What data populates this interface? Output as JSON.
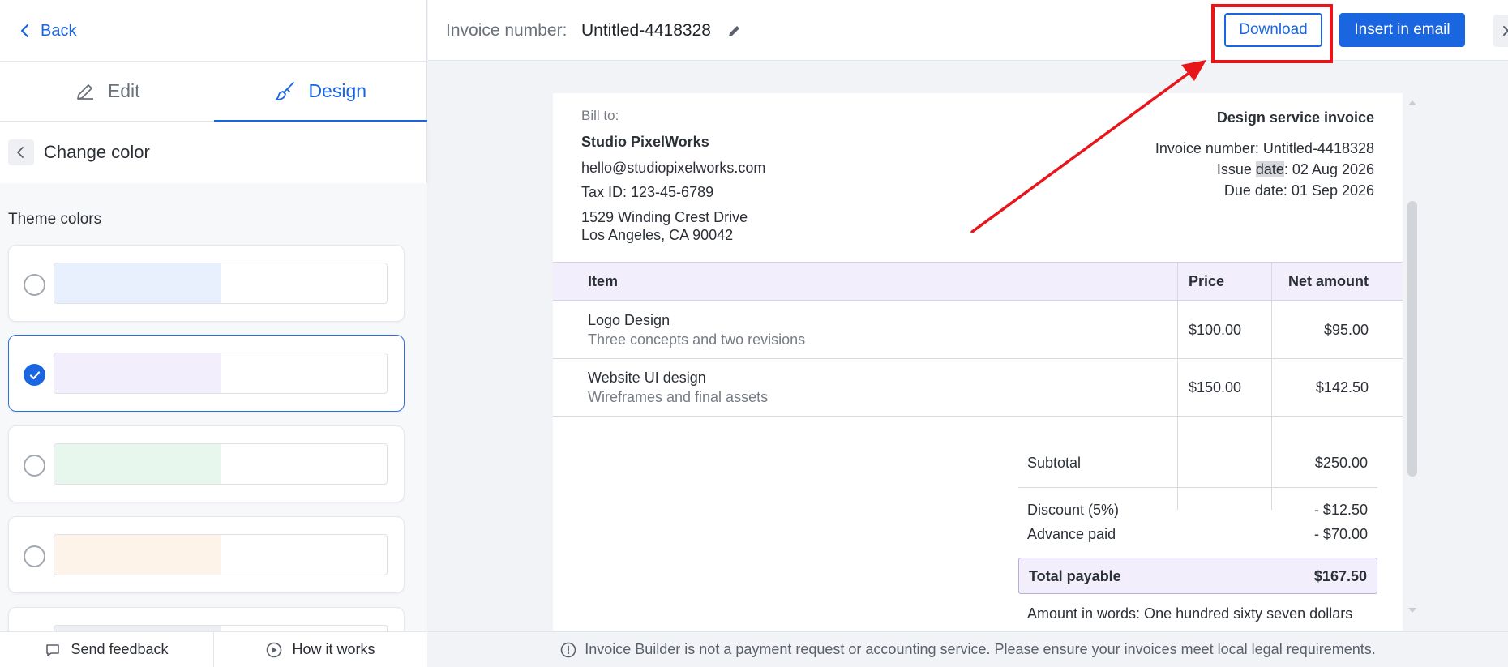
{
  "left_panel": {
    "back_label": "Back",
    "tabs": [
      {
        "label": "Edit",
        "icon": "pencil-icon",
        "active": false
      },
      {
        "label": "Design",
        "icon": "paintbrush-icon",
        "active": true
      }
    ],
    "subheader_title": "Change color",
    "theme_title": "Theme colors",
    "swatches": [
      {
        "color": "#e9f0fd",
        "selected": false
      },
      {
        "color": "#f3eefc",
        "selected": true
      },
      {
        "color": "#e8f7ee",
        "selected": false
      },
      {
        "color": "#fdf3e8",
        "selected": false
      }
    ],
    "footer": {
      "feedback_label": "Send feedback",
      "how_label": "How it works"
    }
  },
  "topbar": {
    "invoice_label": "Invoice number:",
    "invoice_value": "Untitled-4418328",
    "download_label": "Download",
    "insert_label": "Insert in email"
  },
  "invoice": {
    "bill_to_label": "Bill to:",
    "company": "Studio PixelWorks",
    "email": "hello@studiopixelworks.com",
    "tax_id": "Tax ID: 123-45-6789",
    "address_line1": "1529 Winding Crest Drive",
    "address_line2": "Los Angeles, CA 90042",
    "doc_title": "Design service invoice",
    "invoice_number_line": "Invoice number: Untitled-4418328",
    "issue_date_prefix": "Issue ",
    "issue_date_word": "date",
    "issue_date_suffix": ": 02 Aug 2026",
    "due_date_line": "Due date: 01 Sep 2026",
    "columns": {
      "item": "Item",
      "price": "Price",
      "net": "Net amount"
    },
    "items": [
      {
        "name": "Logo Design",
        "desc": "Three concepts and two revisions",
        "price": "$100.00",
        "net": "$95.00"
      },
      {
        "name": "Website UI design",
        "desc": "Wireframes and final assets",
        "price": "$150.00",
        "net": "$142.50"
      }
    ],
    "subtotal_label": "Subtotal",
    "subtotal_value": "$250.00",
    "discount_label": "Discount (5%)",
    "discount_value": "- $12.50",
    "advance_label": "Advance paid",
    "advance_value": "- $70.00",
    "total_label": "Total payable",
    "total_value": "$167.50",
    "amount_words": "Amount in words: One hundred sixty seven dollars"
  },
  "notice": "Invoice Builder is not a payment request or accounting service. Please ensure your invoices meet local legal requirements.",
  "colors": {
    "accent": "#1a66e0",
    "annotation": "#e8151b",
    "table_header": "#f2eefc"
  }
}
